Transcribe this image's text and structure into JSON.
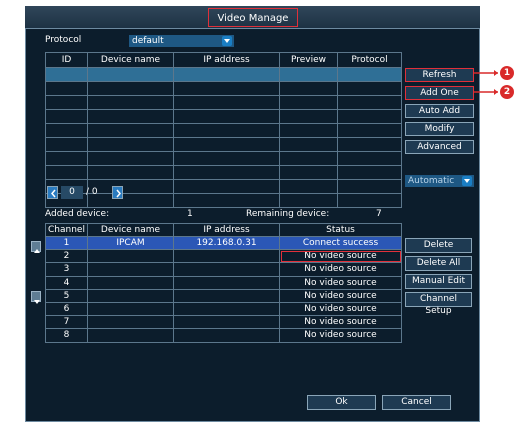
{
  "window": {
    "title": "Video Manage"
  },
  "protocol": {
    "label": "Protocol",
    "value": "default"
  },
  "device_table": {
    "columns": [
      "ID",
      "Device name",
      "IP address",
      "Preview",
      "Protocol"
    ],
    "row_count": 10
  },
  "side_buttons": {
    "refresh": "Refresh",
    "add_one": "Add One",
    "auto_add": "Auto Add",
    "modify": "Modify",
    "advanced": "Advanced"
  },
  "mode_select": {
    "value": "Automatic"
  },
  "paging": {
    "current": "0",
    "total": "/ 0"
  },
  "added": {
    "label": "Added device:",
    "count": "1"
  },
  "remaining": {
    "label": "Remaining device:",
    "count": "7"
  },
  "channel_table": {
    "columns": [
      "Channel",
      "Device name",
      "IP address",
      "Status"
    ],
    "rows": [
      {
        "channel": "1",
        "device": "IPCAM",
        "ip": "192.168.0.31",
        "status": "Connect success"
      },
      {
        "channel": "2",
        "device": "",
        "ip": "",
        "status": "No video source"
      },
      {
        "channel": "3",
        "device": "",
        "ip": "",
        "status": "No video source"
      },
      {
        "channel": "4",
        "device": "",
        "ip": "",
        "status": "No video source"
      },
      {
        "channel": "5",
        "device": "",
        "ip": "",
        "status": "No video source"
      },
      {
        "channel": "6",
        "device": "",
        "ip": "",
        "status": "No video source"
      },
      {
        "channel": "7",
        "device": "",
        "ip": "",
        "status": "No video source"
      },
      {
        "channel": "8",
        "device": "",
        "ip": "",
        "status": "No video source"
      }
    ]
  },
  "channel_buttons": {
    "delete": "Delete",
    "delete_all": "Delete All",
    "manual_edit": "Manual Edit",
    "channel_setup": "Channel Setup"
  },
  "footer": {
    "ok": "Ok",
    "cancel": "Cancel"
  },
  "callouts": [
    "1",
    "2"
  ],
  "colors": {
    "accent": "#1e5884",
    "highlight": "#e0303a",
    "selected_row": "#2b57b6"
  }
}
